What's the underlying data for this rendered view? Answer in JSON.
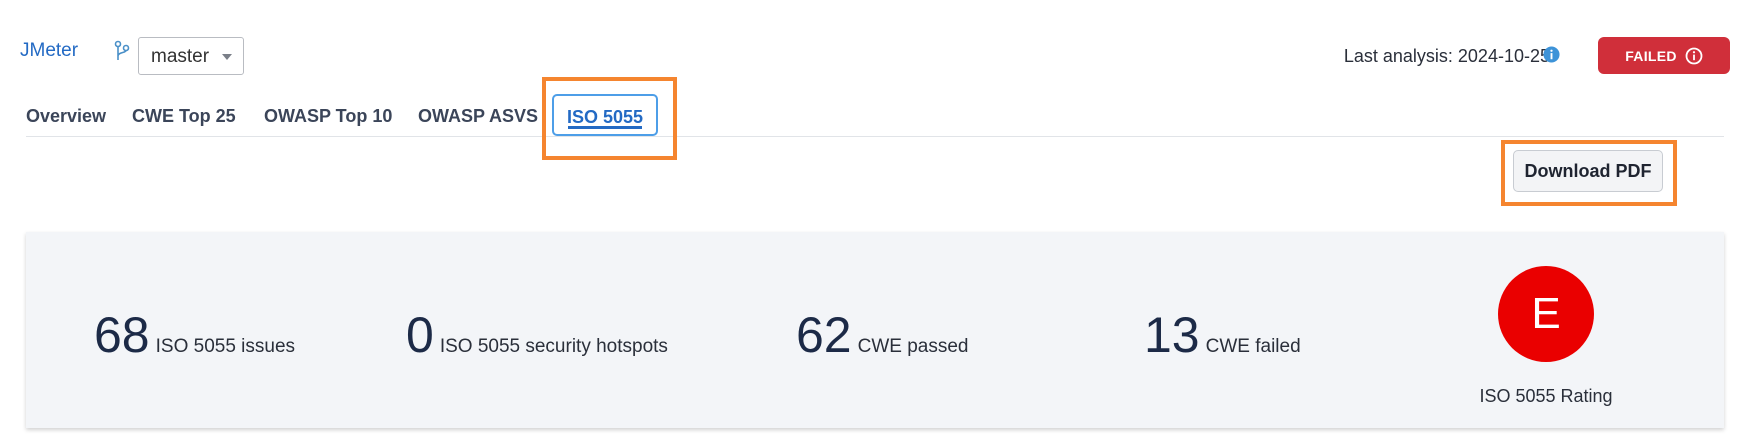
{
  "header": {
    "project_name": "JMeter",
    "branch": "master",
    "last_analysis_label": "Last analysis: 2024-10-25",
    "status_badge": "FAILED"
  },
  "tabs": [
    {
      "label": "Overview",
      "active": false
    },
    {
      "label": "CWE Top 25",
      "active": false
    },
    {
      "label": "OWASP Top 10",
      "active": false
    },
    {
      "label": "OWASP ASVS",
      "active": false
    },
    {
      "label": "ISO 5055",
      "active": true
    }
  ],
  "actions": {
    "download_label": "Download PDF"
  },
  "summary": {
    "metrics": [
      {
        "value": "68",
        "label": "ISO 5055 issues"
      },
      {
        "value": "0",
        "label": "ISO 5055 security hotspots"
      },
      {
        "value": "62",
        "label": "CWE passed"
      },
      {
        "value": "13",
        "label": "CWE failed"
      }
    ],
    "rating": {
      "grade": "E",
      "label": "ISO 5055 Rating"
    }
  },
  "colors": {
    "accent": "#236ac4",
    "failed": "#d02f3a",
    "rating_e": "#ea0000",
    "highlight": "#f5852f"
  },
  "icons": {
    "branch": "branch-icon",
    "info": "info-icon",
    "alert": "info-circle-icon"
  }
}
